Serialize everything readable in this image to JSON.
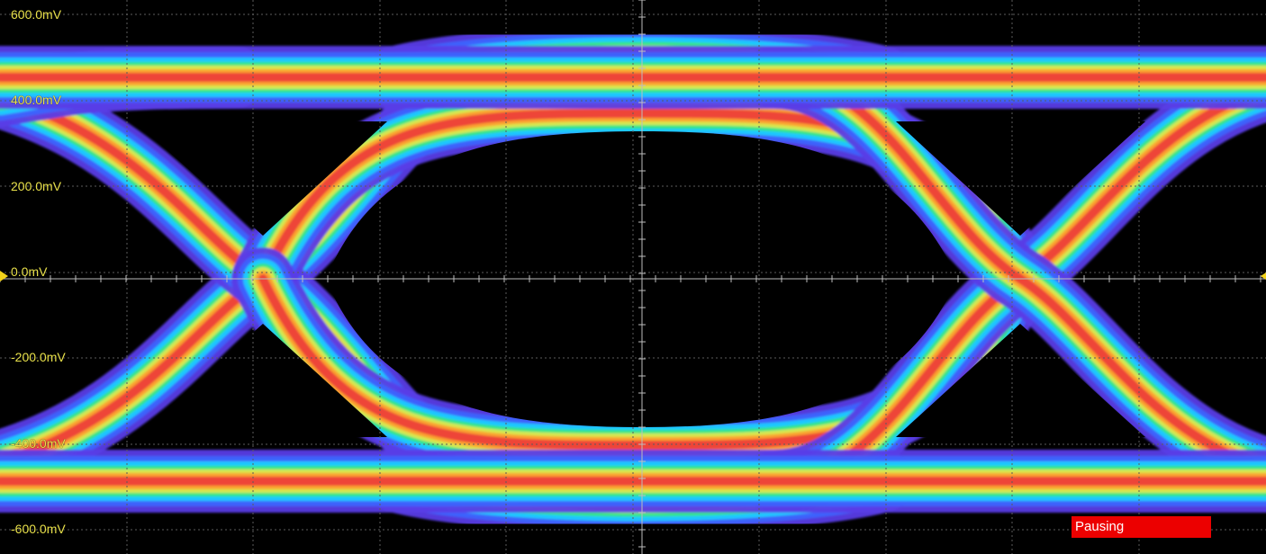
{
  "scope": {
    "display": "eye-diagram",
    "persistence_palette": [
      "#5a3ce6",
      "#3a66ff",
      "#18d4ff",
      "#37e87a",
      "#e8e84a",
      "#ff9a2a",
      "#ec3a3a"
    ],
    "background_color": "#000000",
    "trace_label_color": "#e8e04a"
  },
  "y_axis": {
    "labels": [
      "600.0mV",
      "400.0mV",
      "200.0mV",
      "0.0mV",
      "-200.0mV",
      "-400.0mV",
      "-600.0mV"
    ]
  },
  "status": {
    "label": "Pausing",
    "color": "#ec0000"
  },
  "markers": {
    "left": "ground-level-marker-icon",
    "right": "trigger-level-marker-icon"
  }
}
